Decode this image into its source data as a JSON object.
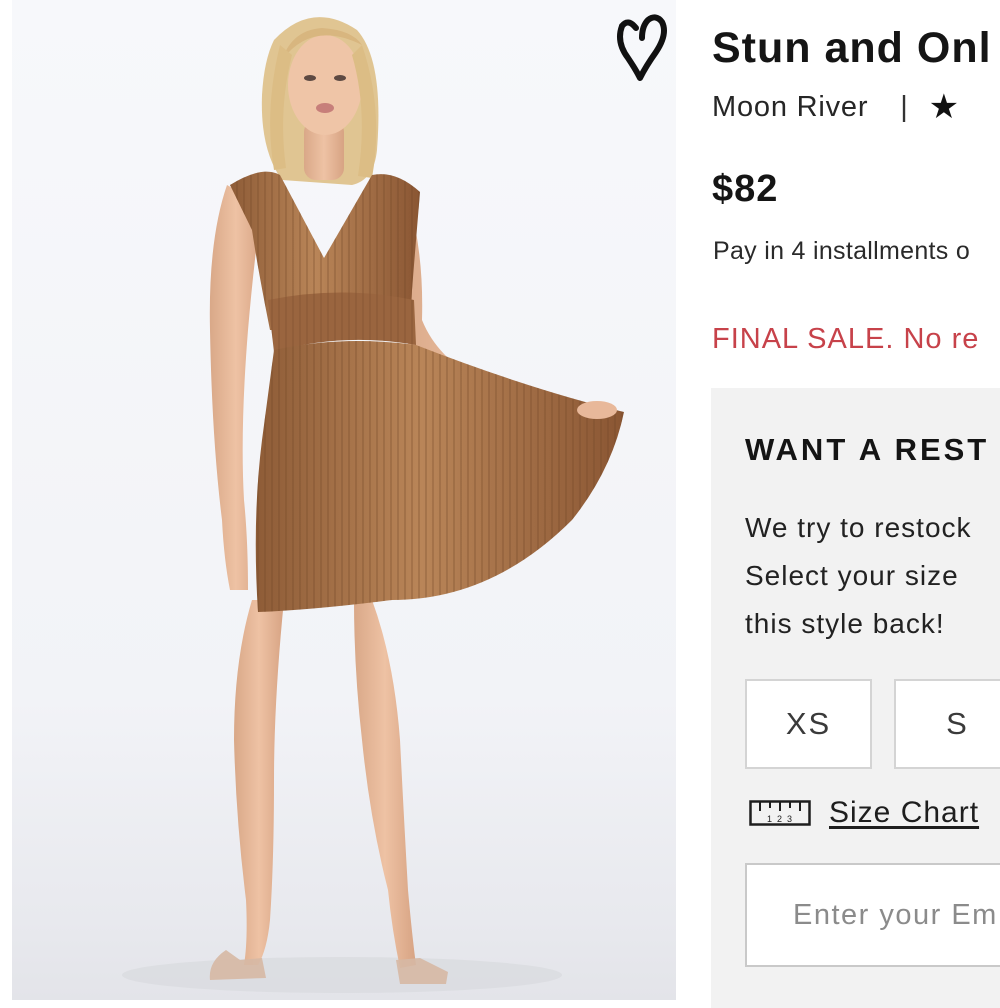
{
  "product": {
    "title": "Stun and Onl",
    "brand": "Moon River",
    "separator": "|",
    "rating_icon": "star-icon",
    "rating_glyph": "★",
    "price": "$82",
    "installments": "Pay in 4 installments o",
    "final_sale": "FINAL SALE. No re",
    "wishlist_icon": "heart-icon"
  },
  "restock": {
    "heading": "WANT A REST",
    "text_lines": [
      "We try to restock",
      "Select your size",
      "this style back!"
    ],
    "sizes": [
      "XS",
      "S"
    ],
    "size_chart_label": "Size Chart",
    "size_chart_icon": "ruler-icon",
    "email_placeholder": "Enter your Em"
  },
  "colors": {
    "final_sale": "#c7424a",
    "panel_bg": "#f2f2f2",
    "dress": "#a9744a"
  }
}
